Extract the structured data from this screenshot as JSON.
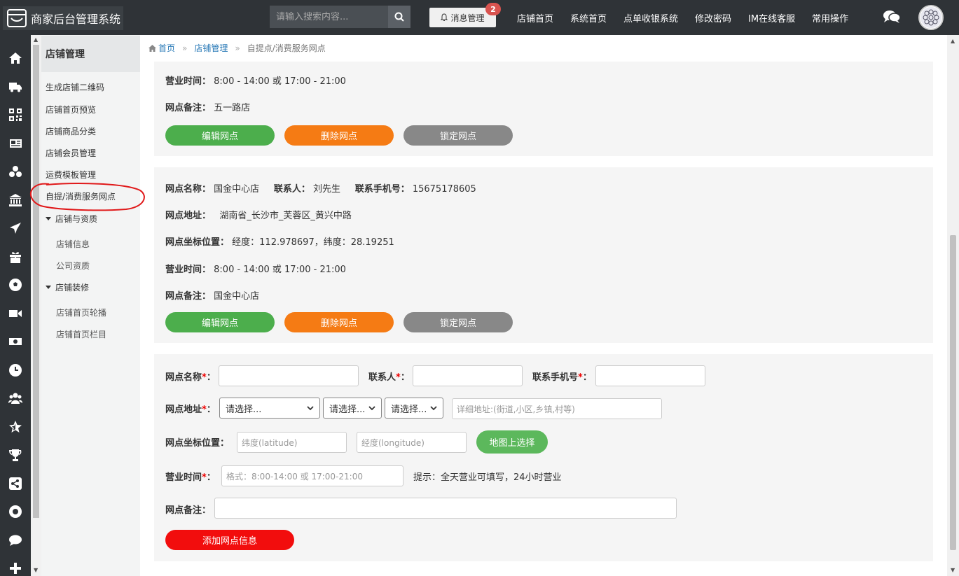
{
  "app": {
    "title": "商家后台管理系统"
  },
  "header": {
    "search_placeholder": "请输入搜索内容...",
    "message_label": "消息管理",
    "message_count": "2",
    "nav": [
      "店铺首页",
      "系统首页",
      "点单收银系统",
      "修改密码",
      "IM在线客服",
      "常用操作"
    ]
  },
  "rail_icons": [
    "home-icon",
    "truck-icon",
    "qrcode-icon",
    "newspaper-icon",
    "cubes-icon",
    "bank-icon",
    "plane-icon",
    "gift-icon",
    "soccer-icon",
    "video-icon",
    "money-icon",
    "clock-icon",
    "users-icon",
    "star-icon",
    "trophy-icon",
    "share-icon",
    "lifering-icon",
    "comment-icon",
    "plus-icon"
  ],
  "submenu": {
    "title": "店铺管理",
    "items": [
      "生成店铺二维码",
      "店铺首页预览",
      "店铺商品分类",
      "店铺会员管理",
      "运费模板管理",
      "自提/消费服务网点"
    ],
    "group1": {
      "label": "店铺与资质",
      "items": [
        "店铺信息",
        "公司资质"
      ]
    },
    "group2": {
      "label": "店铺装修",
      "items": [
        "店铺首页轮播",
        "店铺首页栏目"
      ]
    }
  },
  "breadcrumb": {
    "home": "首页",
    "section": "店铺管理",
    "current": "自提点/消费服务网点",
    "sep": "»"
  },
  "labels": {
    "name": "网点名称：",
    "contact": "联系人：",
    "phone": "联系手机号：",
    "address": "网点地址：",
    "coords": "网点坐标位置：",
    "hours": "营业时间：",
    "remark": "网点备注："
  },
  "store1": {
    "hours": "8:00 - 14:00 或 17:00 - 21:00",
    "remark": "五一路店"
  },
  "store2": {
    "name": "国金中心店",
    "contact": "刘先生",
    "phone": "15675178605",
    "address": "湖南省_长沙市_芙蓉区_黄兴中路",
    "coords": "经度：112.978697，纬度：28.19251",
    "hours": "8:00 - 14:00 或 17:00 - 21:00",
    "remark": "国金中心店"
  },
  "buttons": {
    "edit": "编辑网点",
    "delete": "删除网点",
    "lock": "锁定网点",
    "map": "地图上选择",
    "add": "添加网点信息"
  },
  "form": {
    "name_label": "网点名称",
    "contact_label": "联系人",
    "phone_label": "联系手机号",
    "address_label": "网点地址",
    "coords_label": "网点坐标位置：",
    "hours_label": "营业时间",
    "remark_label": "网点备注：",
    "req_mark": "*",
    "colon": "：",
    "select_placeholder": "请选择...",
    "detail_placeholder": "详细地址:(街道,小区,乡镇,村等)",
    "lat_placeholder": "纬度(latitude)",
    "lng_placeholder": "经度(longitude)",
    "hours_placeholder": "格式：8:00-14:00 或 17:00-21:00",
    "hours_hint": "提示：全天营业可填写，24小时营业"
  },
  "colors": {
    "topbar": "#2f3337",
    "green": "#4cae4c",
    "orange": "#f57b14",
    "gray": "#888888",
    "red": "#f20d0d",
    "link": "#2a7ab7"
  }
}
